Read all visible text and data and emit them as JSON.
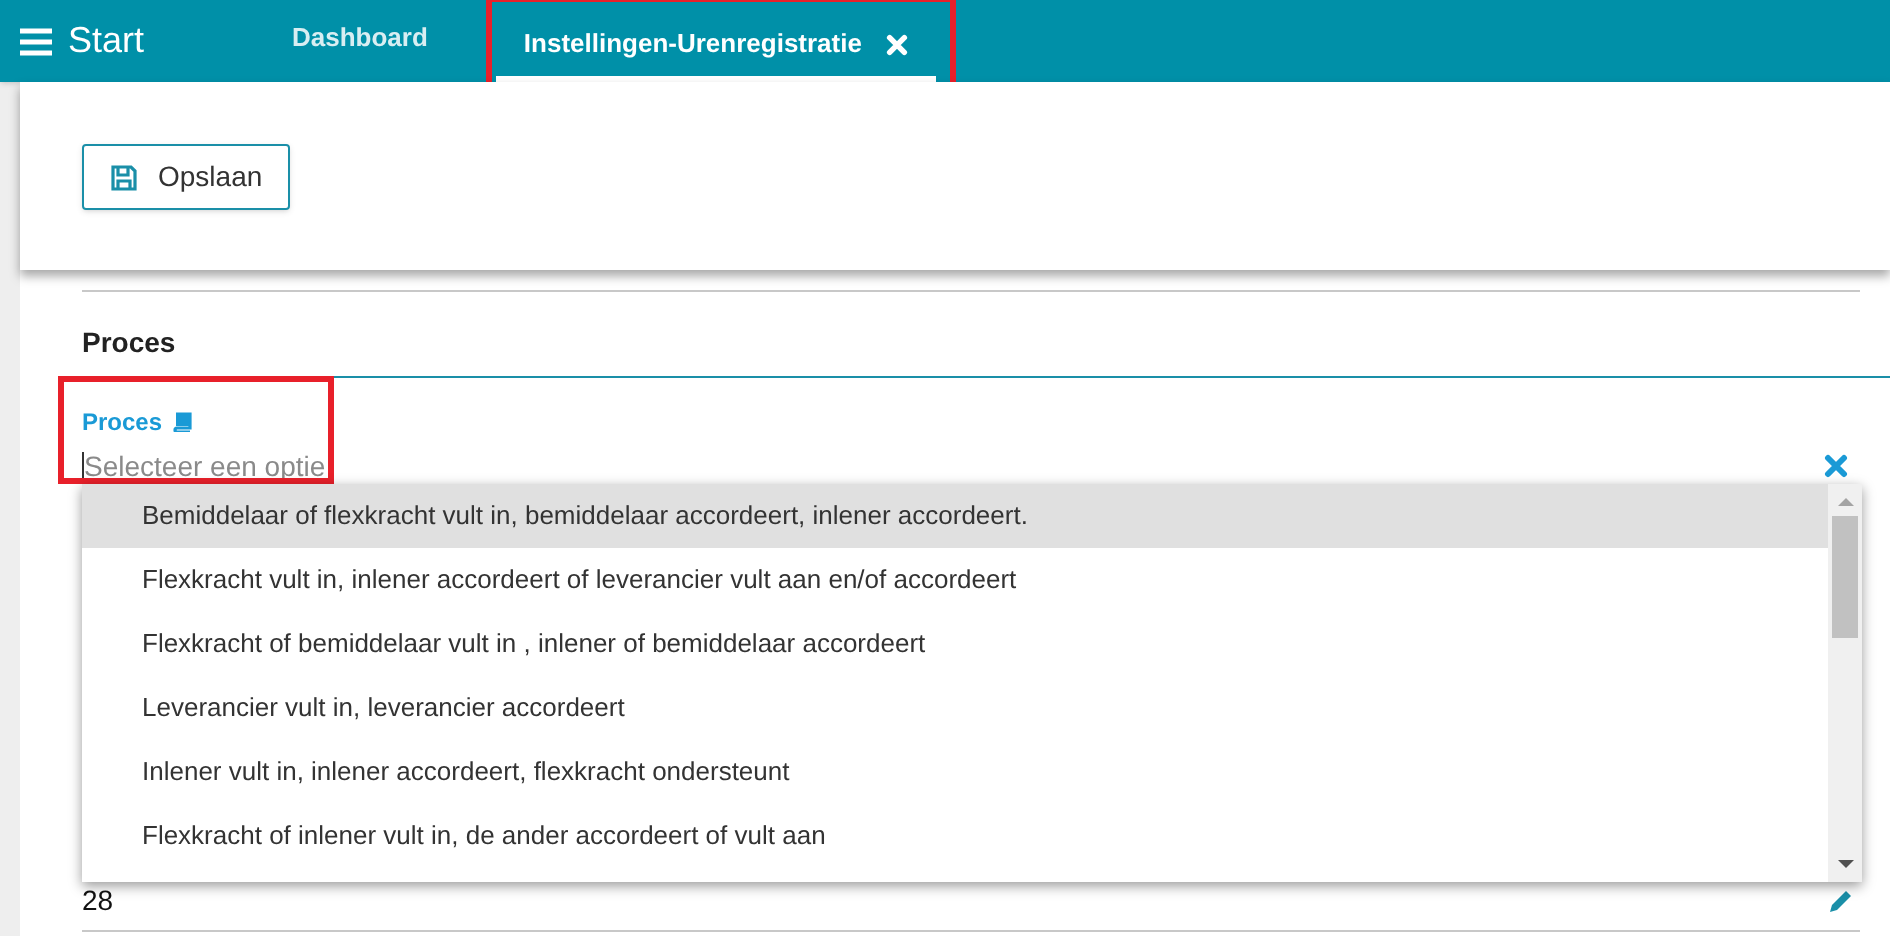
{
  "topbar": {
    "menu_label": "Start",
    "tabs": [
      {
        "label": "Dashboard",
        "selected": false,
        "closable": false,
        "highlighted": false
      },
      {
        "label": "Instellingen-Urenregistratie",
        "selected": true,
        "closable": true,
        "highlighted": true
      }
    ]
  },
  "toolbar": {
    "save_button": "Opslaan"
  },
  "section": {
    "title": "Proces"
  },
  "field": {
    "label": "Proces",
    "placeholder": "Selecteer een optie",
    "highlighted": true
  },
  "options": [
    {
      "label": "Bemiddelaar of flexkracht vult in, bemiddelaar accordeert, inlener accordeert.",
      "selected": true
    },
    {
      "label": "Flexkracht vult in, inlener accordeert of leverancier vult aan en/of accordeert",
      "selected": false
    },
    {
      "label": "Flexkracht of bemiddelaar vult in , inlener of bemiddelaar accordeert",
      "selected": false
    },
    {
      "label": "Leverancier vult in, leverancier accordeert",
      "selected": false
    },
    {
      "label": "Inlener vult in, inlener accordeert, flexkracht ondersteunt",
      "selected": false
    },
    {
      "label": "Flexkracht of inlener vult in, de ander accordeert of vult aan",
      "selected": false
    }
  ],
  "next_field": {
    "value": "28"
  }
}
